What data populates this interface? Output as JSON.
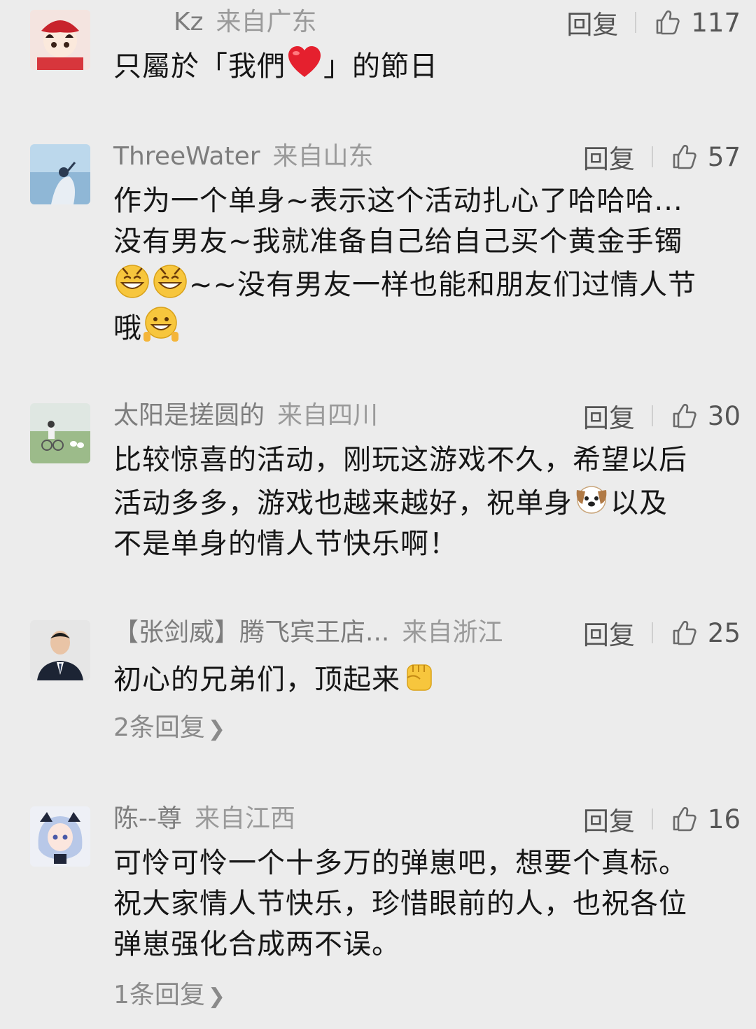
{
  "comments": [
    {
      "user": "Kz",
      "location": "来自广东",
      "reply_label": "回复",
      "likes": "117",
      "text_before": "只屬於「我們",
      "text_after": "」的節日"
    },
    {
      "user": "ThreeWater",
      "location": "来自山东",
      "reply_label": "回复",
      "likes": "57",
      "line1": "作为一个单身~表示这个活动扎心了哈哈哈...",
      "line2": "没有男友~我就准备自己给自己买个黄金手镯",
      "line3": "~~没有男友一样也能和朋友们过情人节",
      "line4": "哦"
    },
    {
      "user": "太阳是搓圆的",
      "location": "来自四川",
      "reply_label": "回复",
      "likes": "30",
      "line1": "比较惊喜的活动，刚玩这游戏不久，希望以后",
      "line2a": "活动多多，游戏也越来越好，祝单身",
      "line2b": "以及",
      "line3": "不是单身的情人节快乐啊！"
    },
    {
      "user": "【张剑威】腾飞宾王店...",
      "location": "来自浙江",
      "reply_label": "回复",
      "likes": "25",
      "line1": "初心的兄弟们，顶起来",
      "more_replies": "2条回复"
    },
    {
      "user": "陈--尊",
      "location": "来自江西",
      "reply_label": "回复",
      "likes": "16",
      "line1": "可怜可怜一个十多万的弹崽吧，想要个真标。",
      "line2": "祝大家情人节快乐，珍惜眼前的人，也祝各位",
      "line3": "弹崽强化合成两不误。",
      "more_replies": "1条回复"
    }
  ],
  "icons": {
    "like": "thumbs-up-outline-icon",
    "more": "chevron-right-icon"
  }
}
